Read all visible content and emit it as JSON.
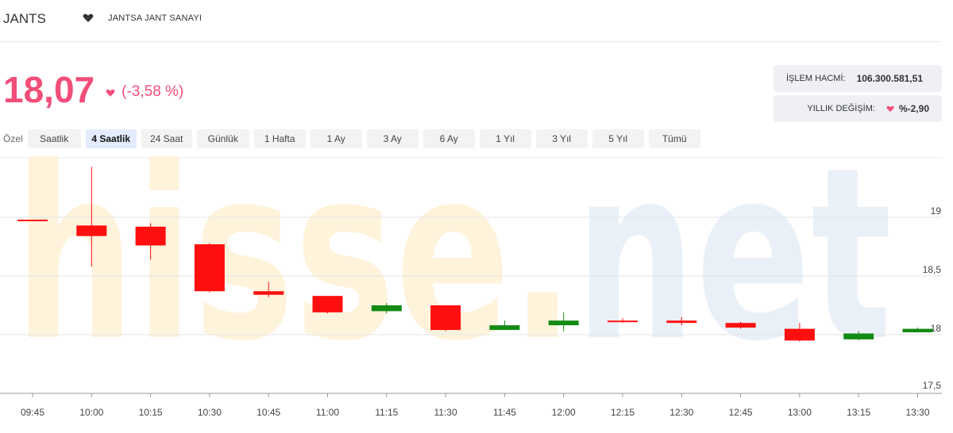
{
  "header": {
    "symbol": "JANTS",
    "company": "JANTSA JANT SANAYI"
  },
  "price": {
    "value": "18,07",
    "change": "(-3,58 %)"
  },
  "stats": {
    "volume_label": "İŞLEM HACMİ:",
    "volume_value": "106.300.581,51",
    "annual_label": "YILLIK DEĞİŞİM:",
    "annual_value": "%-2,90"
  },
  "ranges": {
    "custom_label": "Özel",
    "tabs": [
      "Saatlik",
      "4 Saatlik",
      "24 Saat",
      "Günlük",
      "1 Hafta",
      "1 Ay",
      "3 Ay",
      "6 Ay",
      "1 Yıl",
      "3 Yıl",
      "5 Yıl",
      "Tümü"
    ],
    "active": "4 Saatlik"
  },
  "colors": {
    "accent": "#f24e7a",
    "up": "#138a13",
    "down": "#ff0f0f"
  },
  "chart_data": {
    "type": "candlestick",
    "x": [
      "09:45",
      "10:00",
      "10:15",
      "10:30",
      "10:45",
      "11:00",
      "11:15",
      "11:30",
      "11:45",
      "12:00",
      "12:15",
      "12:30",
      "12:45",
      "13:00",
      "13:15",
      "13:30"
    ],
    "open": [
      18.98,
      18.93,
      18.92,
      18.77,
      18.37,
      18.33,
      18.2,
      18.25,
      18.04,
      18.08,
      18.12,
      18.12,
      18.1,
      18.05,
      17.96,
      18.02
    ],
    "high": [
      18.98,
      19.43,
      18.95,
      18.78,
      18.45,
      18.33,
      18.27,
      18.25,
      18.12,
      18.19,
      18.14,
      18.15,
      18.11,
      18.1,
      18.03,
      18.06
    ],
    "low": [
      18.98,
      18.58,
      18.64,
      18.36,
      18.32,
      18.18,
      18.18,
      18.03,
      18.04,
      18.03,
      18.1,
      18.08,
      18.05,
      17.94,
      17.95,
      18.02
    ],
    "close": [
      18.98,
      18.84,
      18.76,
      18.37,
      18.34,
      18.19,
      18.25,
      18.04,
      18.08,
      18.12,
      18.11,
      18.1,
      18.06,
      17.95,
      18.01,
      18.05
    ],
    "y_ticks": [
      "19",
      "18,5",
      "18",
      "17,5"
    ],
    "ylim": [
      17.5,
      19.5
    ],
    "grid": true,
    "watermark": "hisse.net"
  }
}
